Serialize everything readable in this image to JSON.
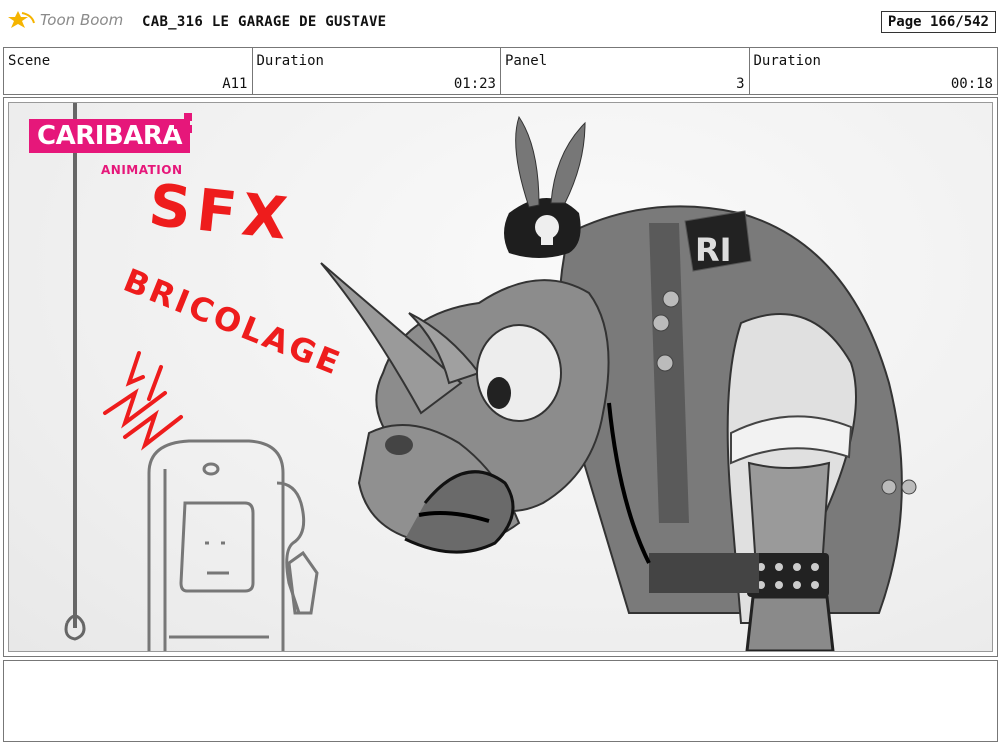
{
  "header": {
    "app_name": "Toon Boom",
    "title": "CAB_316  LE GARAGE DE GUSTAVE",
    "page": "Page 166/542"
  },
  "info": {
    "scene_label": "Scene",
    "scene_value": "A11",
    "duration_label": "Duration",
    "duration_value": "01:23",
    "panel_label": "Panel",
    "panel_value": "3",
    "panel_duration_label": "Duration",
    "panel_duration_value": "00:18"
  },
  "panel_art": {
    "studio_name": "CARIBARA",
    "studio_sub": "ANIMATION",
    "sfx_line1": "SFX",
    "sfx_line2": "BRICOLAGE",
    "accent_color": "#e6177a",
    "sfx_color": "#ee1c1c"
  },
  "caption": {
    "text": ""
  }
}
